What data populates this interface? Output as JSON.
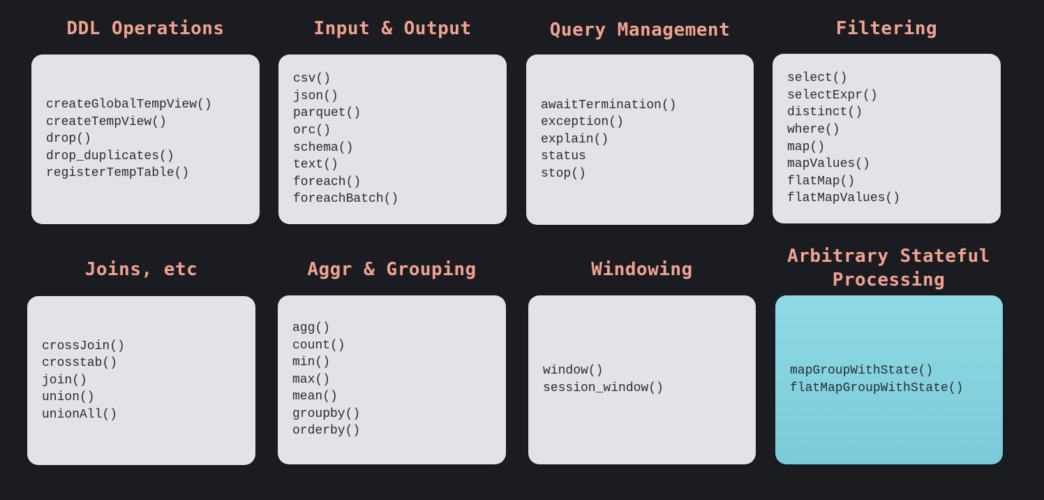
{
  "groups": [
    {
      "title": "DDL Operations",
      "items": [
        "createGlobalTempView()",
        "createTempView()",
        "drop()",
        "drop_duplicates()",
        "registerTempTable()"
      ]
    },
    {
      "title": "Input & Output",
      "items": [
        "csv()",
        "json()",
        "parquet()",
        "orc()",
        "schema()",
        "text()",
        "foreach()",
        "foreachBatch()"
      ]
    },
    {
      "title": "Query Management",
      "items": [
        "awaitTermination()",
        "exception()",
        "explain()",
        "status",
        "stop()"
      ]
    },
    {
      "title": "Filtering",
      "items": [
        "select()",
        "selectExpr()",
        "distinct()",
        "where()",
        "map()",
        "mapValues()",
        "flatMap()",
        "flatMapValues()"
      ]
    },
    {
      "title": "Joins, etc",
      "items": [
        "crossJoin()",
        "crosstab()",
        "join()",
        "union()",
        "unionAll()"
      ]
    },
    {
      "title": "Aggr & Grouping",
      "items": [
        "agg()",
        "count()",
        "min()",
        "max()",
        "mean()",
        "groupby()",
        "orderby()"
      ]
    },
    {
      "title": "Windowing",
      "items": [
        "window()",
        "session_window()"
      ]
    },
    {
      "title": "Arbitrary Stateful\nProcessing",
      "items": [
        "mapGroupWithState()",
        "flatMapGroupWithState()"
      ],
      "highlight_color": "#7fcfdc"
    }
  ],
  "colors": {
    "background": "#1b1c22",
    "title": "#f2a38e",
    "card": "#e2e3e6",
    "card_text": "#2a2b30",
    "highlight": "#7fcfdc"
  }
}
